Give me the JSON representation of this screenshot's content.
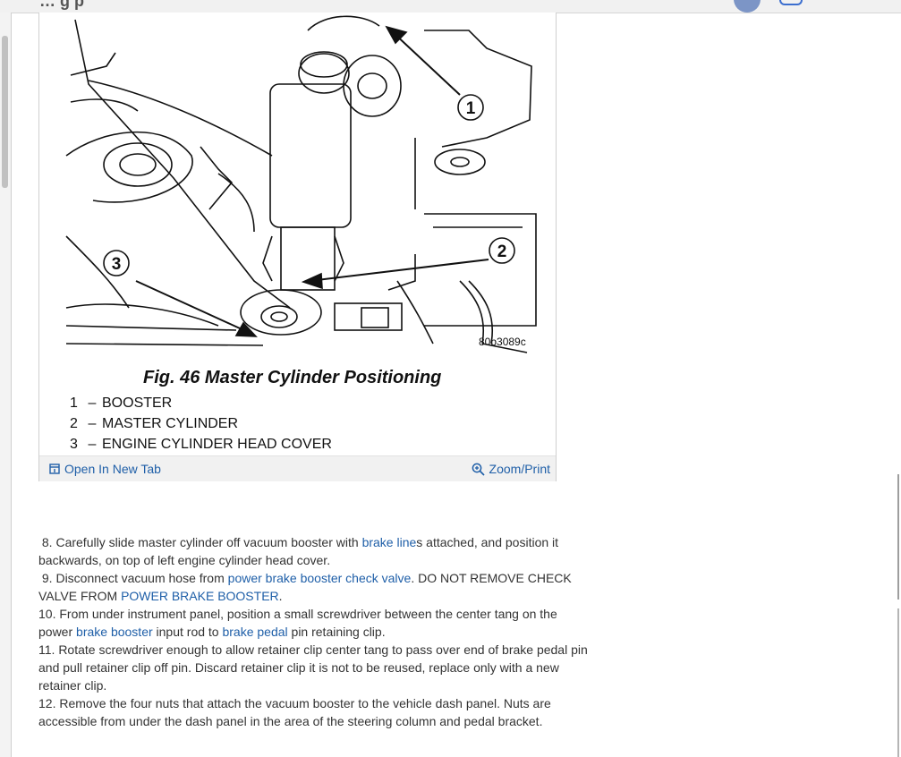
{
  "header": {
    "title_fragment": "… g  p"
  },
  "figure": {
    "callouts": [
      "1",
      "2",
      "3"
    ],
    "image_code": "80b3089c",
    "caption": "Fig. 46 Master Cylinder Positioning",
    "legend": [
      {
        "num": "1",
        "label": "BOOSTER"
      },
      {
        "num": "2",
        "label": "MASTER CYLINDER"
      },
      {
        "num": "3",
        "label": "ENGINE CYLINDER HEAD COVER"
      }
    ],
    "legend_dash": "–",
    "open_tab_label": "Open In New Tab",
    "zoom_label": "Zoom/Print"
  },
  "steps": {
    "s8": {
      "pre": "8. Carefully slide master cylinder off vacuum booster with ",
      "link": "brake line",
      "post": "s attached, and position it backwards, on top of left engine cylinder head cover."
    },
    "s9": {
      "pre": "9. Disconnect vacuum hose from ",
      "link1": "power brake booster check valve",
      "mid": ". DO NOT REMOVE CHECK VALVE FROM ",
      "link2": "POWER BRAKE BOOSTER",
      "post": "."
    },
    "s10": {
      "pre": "10. From under instrument panel, position a small screwdriver between the center tang on the power ",
      "link1": "brake booster",
      "mid": " input rod to ",
      "link2": "brake pedal",
      "post": " pin retaining clip."
    },
    "s11": {
      "text": "11. Rotate screwdriver enough to allow retainer clip center tang to pass over end of brake pedal pin and pull retainer clip off pin. Discard retainer clip it is not to be reused, replace only with a new retainer clip."
    },
    "s12": {
      "text": "12. Remove the four nuts that attach the vacuum booster to the vehicle dash panel. Nuts are accessible from under the dash panel in the area of the steering column and pedal bracket."
    }
  },
  "colors": {
    "link": "#1f5fa8",
    "footer_bg": "#f1f1f1"
  },
  "icons": {
    "open_tab": "open-in-new-tab-icon",
    "zoom": "zoom-in-icon"
  }
}
